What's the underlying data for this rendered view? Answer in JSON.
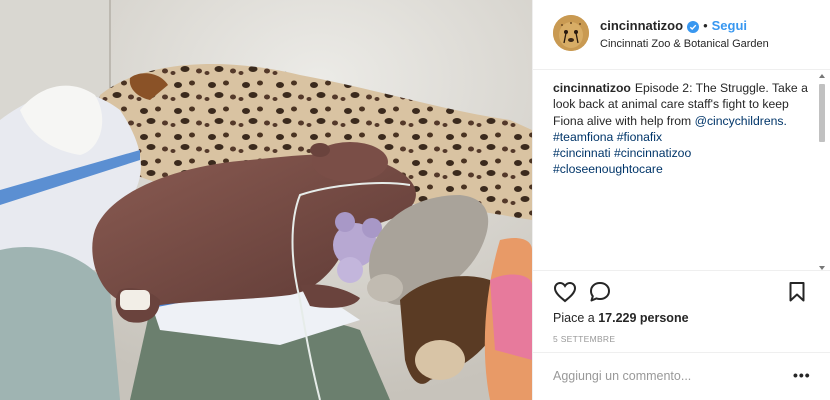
{
  "post": {
    "username": "cincinnatizoo",
    "dot": "•",
    "follow_label": "Segui",
    "location": "Cincinnati Zoo & Botanical Garden",
    "caption": {
      "username": "cincinnatizoo",
      "text": "Episode 2: The Struggle. Take a look back at animal care staff's fight to keep Fiona alive with help from",
      "mention": "@cincychildrens.",
      "hashtags_line1": [
        "#teamfiona",
        "#fionafix"
      ],
      "hashtags_line2": [
        "#cincinnati",
        "#cincinnatizoo"
      ],
      "hashtags_line3": [
        "#closeenoughtocare"
      ]
    },
    "likes_prefix": "Piace a",
    "likes_count": "17.229",
    "likes_suffix": "persone",
    "date": "5 SETTEMBRE",
    "comment_placeholder": "Aggiungi un commento...",
    "more_label": "•••"
  },
  "icons": {
    "like": "heart-icon",
    "comment": "comment-icon",
    "save": "bookmark-icon",
    "verified": "verified-badge-icon",
    "avatar": "cheetah-avatar"
  },
  "colors": {
    "link": "#3897f0",
    "hashtag": "#003569",
    "text": "#262626",
    "muted": "#999999",
    "verified": "#3897f0"
  }
}
